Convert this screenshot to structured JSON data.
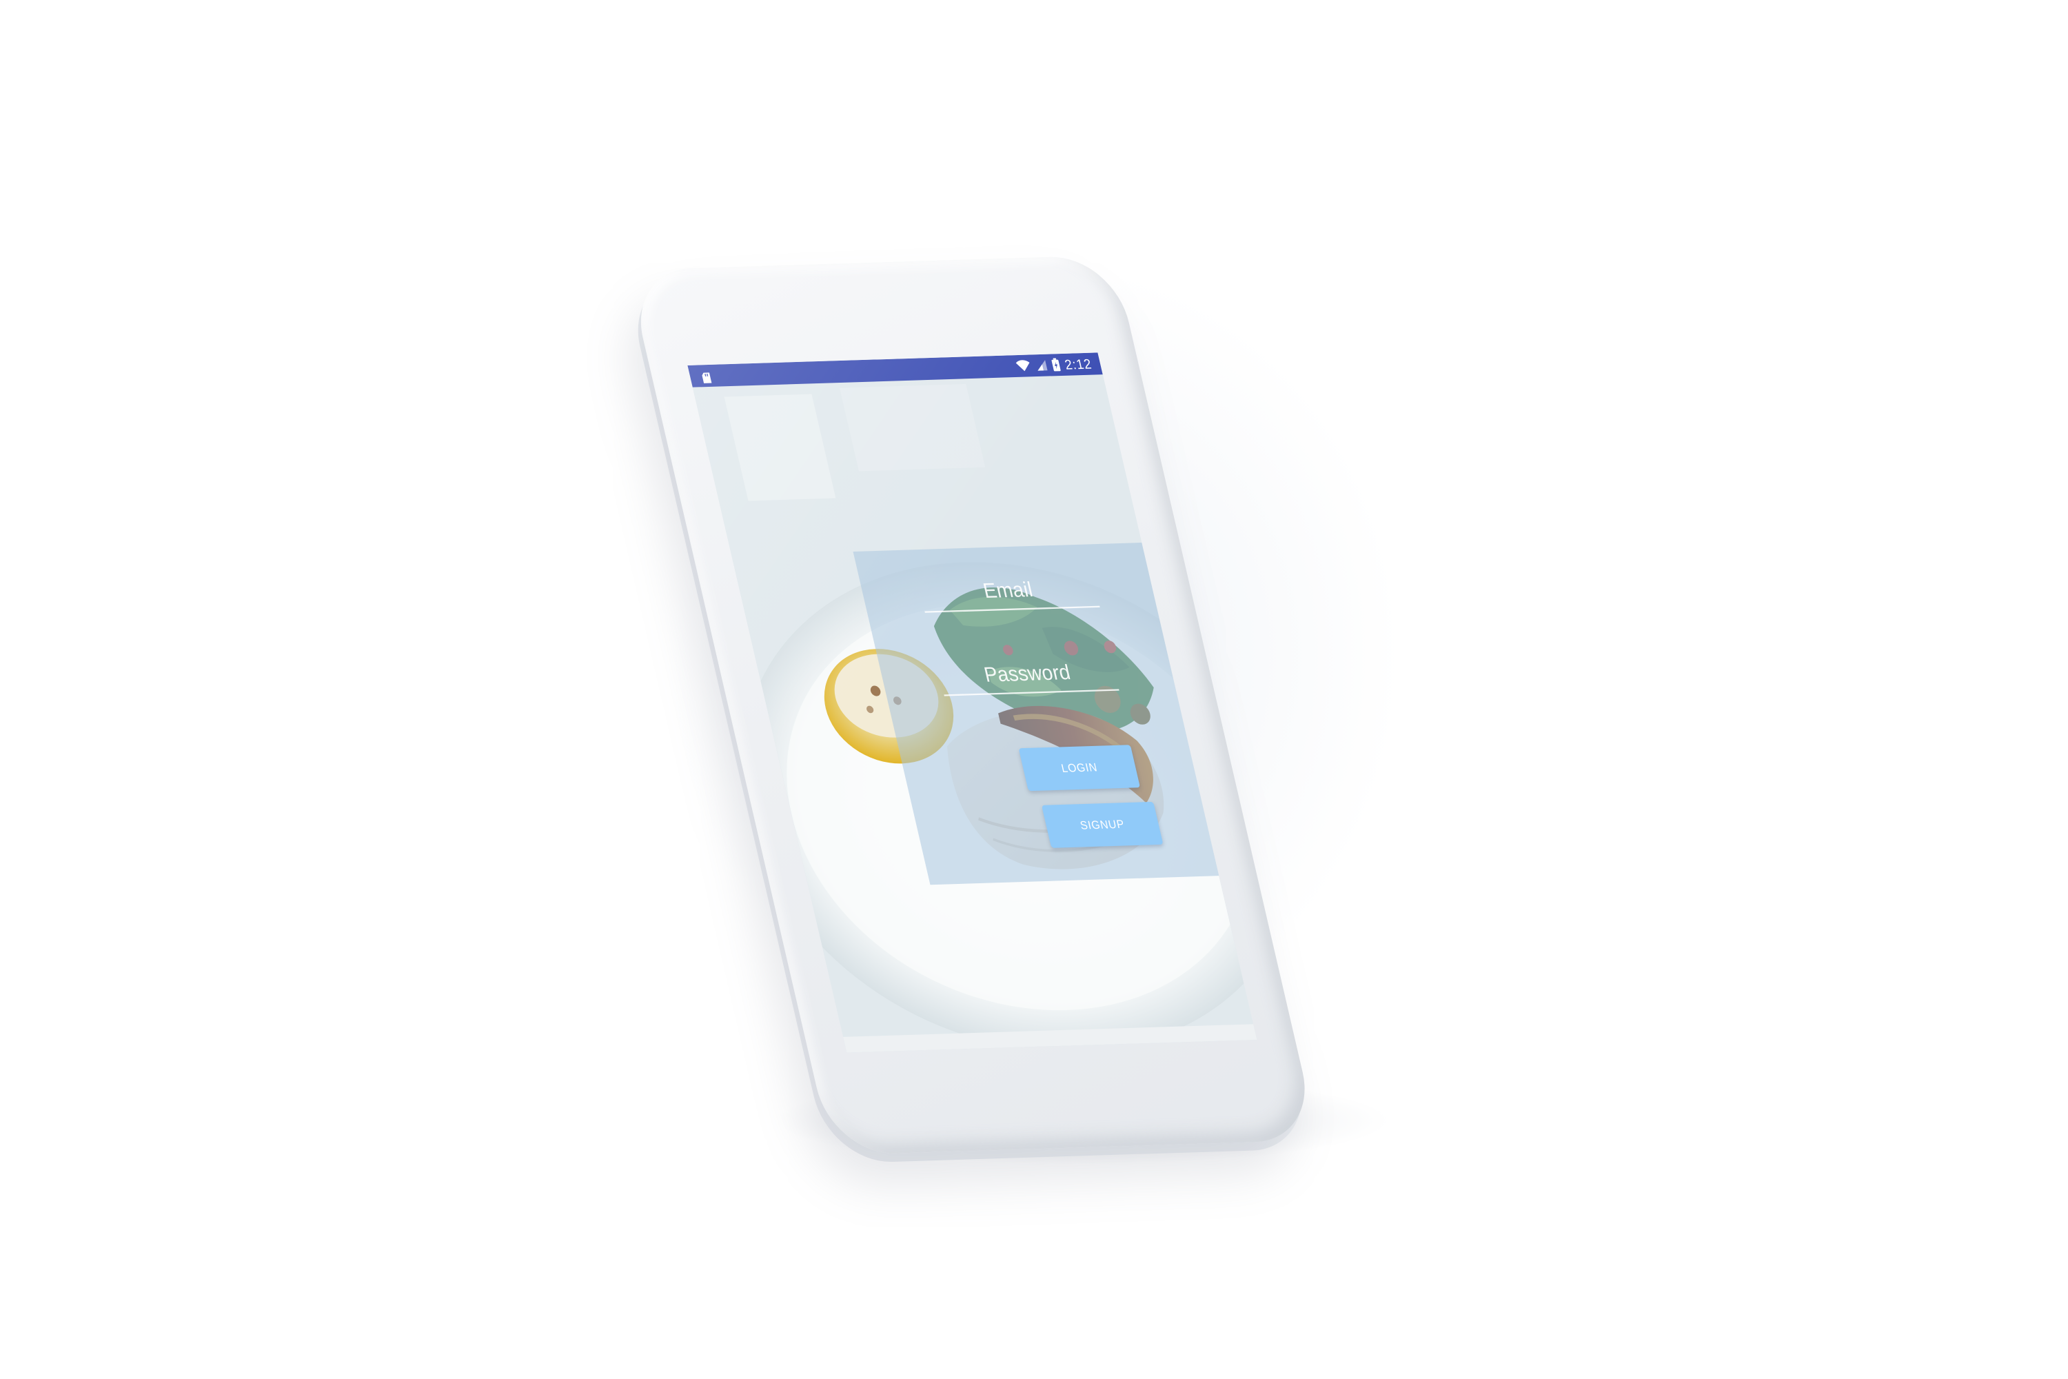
{
  "status_bar": {
    "time": "2:12",
    "color": "#3f51b5",
    "icons": [
      "sd-card-icon",
      "wifi-icon",
      "signal-icon",
      "battery-icon"
    ]
  },
  "login_form": {
    "email_placeholder": "Email",
    "password_placeholder": "Password",
    "login_label": "LOGIN",
    "signup_label": "SIGNUP",
    "button_color": "#90caf9"
  },
  "background_image": "plated grilled fish with lemon and green salad"
}
